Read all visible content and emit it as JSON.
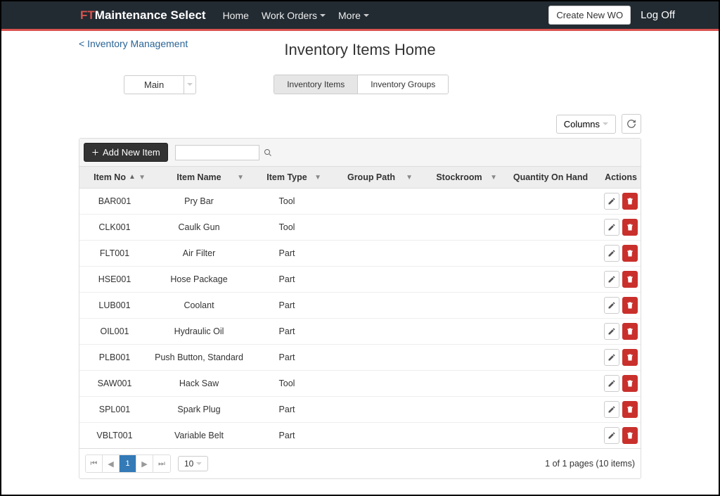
{
  "navbar": {
    "brand_prefix": "FT",
    "brand_rest": "Maintenance Select",
    "links": {
      "home": "Home",
      "work_orders": "Work Orders",
      "more": "More"
    },
    "create_wo": "Create New WO",
    "logoff": "Log Off"
  },
  "breadcrumb": "< Inventory Management",
  "page_title": "Inventory Items Home",
  "dropdown_main": "Main",
  "tabs": {
    "items": "Inventory Items",
    "groups": "Inventory Groups"
  },
  "toolbar": {
    "columns": "Columns",
    "add_item": "Add New Item"
  },
  "headers": {
    "item_no": "Item No",
    "item_name": "Item Name",
    "item_type": "Item Type",
    "group_path": "Group Path",
    "stockroom": "Stockroom",
    "qty": "Quantity On Hand",
    "actions": "Actions"
  },
  "rows": [
    {
      "no": "BAR001",
      "name": "Pry Bar",
      "type": "Tool"
    },
    {
      "no": "CLK001",
      "name": "Caulk Gun",
      "type": "Tool"
    },
    {
      "no": "FLT001",
      "name": "Air Filter",
      "type": "Part"
    },
    {
      "no": "HSE001",
      "name": "Hose Package",
      "type": "Part"
    },
    {
      "no": "LUB001",
      "name": "Coolant",
      "type": "Part"
    },
    {
      "no": "OIL001",
      "name": "Hydraulic Oil",
      "type": "Part"
    },
    {
      "no": "PLB001",
      "name": "Push Button, Standard",
      "type": "Part"
    },
    {
      "no": "SAW001",
      "name": "Hack Saw",
      "type": "Tool"
    },
    {
      "no": "SPL001",
      "name": "Spark Plug",
      "type": "Part"
    },
    {
      "no": "VBLT001",
      "name": "Variable Belt",
      "type": "Part"
    }
  ],
  "pager": {
    "current": "1",
    "size": "10",
    "info": "1 of 1 pages (10 items)"
  }
}
